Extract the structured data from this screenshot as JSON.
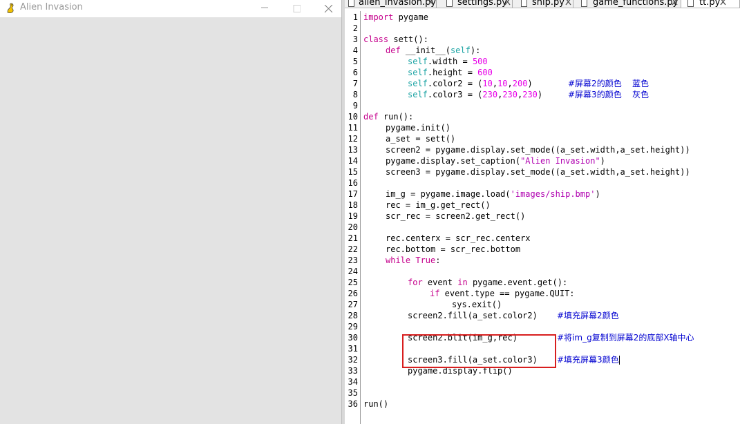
{
  "pygame_window": {
    "title": "Alien Invasion",
    "logo_icon": "pygame-snake-icon",
    "background_color": "#e3e3e3"
  },
  "editor": {
    "tabs": [
      {
        "label": "alien_invasion.py",
        "icon": "document-icon",
        "active": false
      },
      {
        "label": "settings.py",
        "icon": "document-icon",
        "active": false
      },
      {
        "label": "ship.py",
        "icon": "document-icon",
        "active": false
      },
      {
        "label": "game_functions.py",
        "icon": "document-icon",
        "active": false
      },
      {
        "label": "tt.py",
        "icon": "document-icon",
        "active": true
      }
    ],
    "line_numbers": [
      "1",
      "2",
      "3",
      "4",
      "5",
      "6",
      "7",
      "8",
      "9",
      "10",
      "11",
      "12",
      "13",
      "14",
      "15",
      "16",
      "17",
      "18",
      "19",
      "20",
      "21",
      "22",
      "23",
      "24",
      "25",
      "26",
      "27",
      "28",
      "29",
      "30",
      "31",
      "32",
      "33",
      "34",
      "35",
      "36"
    ],
    "code": {
      "l1_kw": "import",
      "l1_rest": " pygame",
      "l3_kw": "class",
      "l3_rest": " sett():",
      "l4_kw": "def",
      "l4_rest": " __init__(",
      "l4_self": "self",
      "l4_end": "):",
      "l5_self": "self",
      "l5_mid": ".width = ",
      "l5_num": "500",
      "l6_self": "self",
      "l6_mid": ".height = ",
      "l6_num": "600",
      "l7_self": "self",
      "l7_mid": ".color2 = (",
      "l7_n1": "10",
      "l7_n2": "10",
      "l7_n3": "200",
      "l7_end": ")",
      "l7_comment": "#屏幕2的颜色    蓝色",
      "l8_self": "self",
      "l8_mid": ".color3 = (",
      "l8_n1": "230",
      "l8_n2": "230",
      "l8_n3": "230",
      "l8_end": ")",
      "l8_comment": "#屏幕3的颜色    灰色",
      "l10_kw": "def",
      "l10_rest": " run():",
      "l11": "pygame.init()",
      "l12": "a_set = sett()",
      "l13": "screen2 = pygame.display.set_mode((a_set.width,a_set.height))",
      "l14_a": "pygame.display.set_caption(",
      "l14_str": "\"Alien Invasion\"",
      "l14_b": ")",
      "l15": "screen3 = pygame.display.set_mode((a_set.width,a_set.height))",
      "l17_a": "im_g = pygame.image.load(",
      "l17_str": "'images/ship.bmp'",
      "l17_b": ")",
      "l18": "rec = im_g.get_rect()",
      "l19": "scr_rec = screen2.get_rect()",
      "l21": "rec.centerx = scr_rec.centerx",
      "l22": "rec.bottom = scr_rec.bottom",
      "l23_kw": "while",
      "l23_true": "True",
      "l23_end": ":",
      "l25_kw": "for",
      "l25_mid": " event ",
      "l25_in": "in",
      "l25_rest": " pygame.event.get():",
      "l26_kw": "if",
      "l26_rest": " event.type == pygame.QUIT:",
      "l27": "sys.exit()",
      "l28": "screen2.fill(a_set.color2)",
      "l28_comment": "#填充屏幕2颜色",
      "l30": "screen2.blit(im_g,rec)",
      "l30_comment": "#将im_g复制到屏幕2的底部X轴中心",
      "l32": "screen3.fill(a_set.color3)",
      "l32_comment": "#填充屏幕3颜色",
      "l33": "pygame.display.flip()",
      "l36": "run()"
    }
  },
  "colors": {
    "keyword": "#c5008c",
    "self": "#1aa3a3",
    "number": "#e800e8",
    "string": "#b000b0",
    "comment": "#0000d0",
    "highlight_box": "#d81e1e"
  }
}
